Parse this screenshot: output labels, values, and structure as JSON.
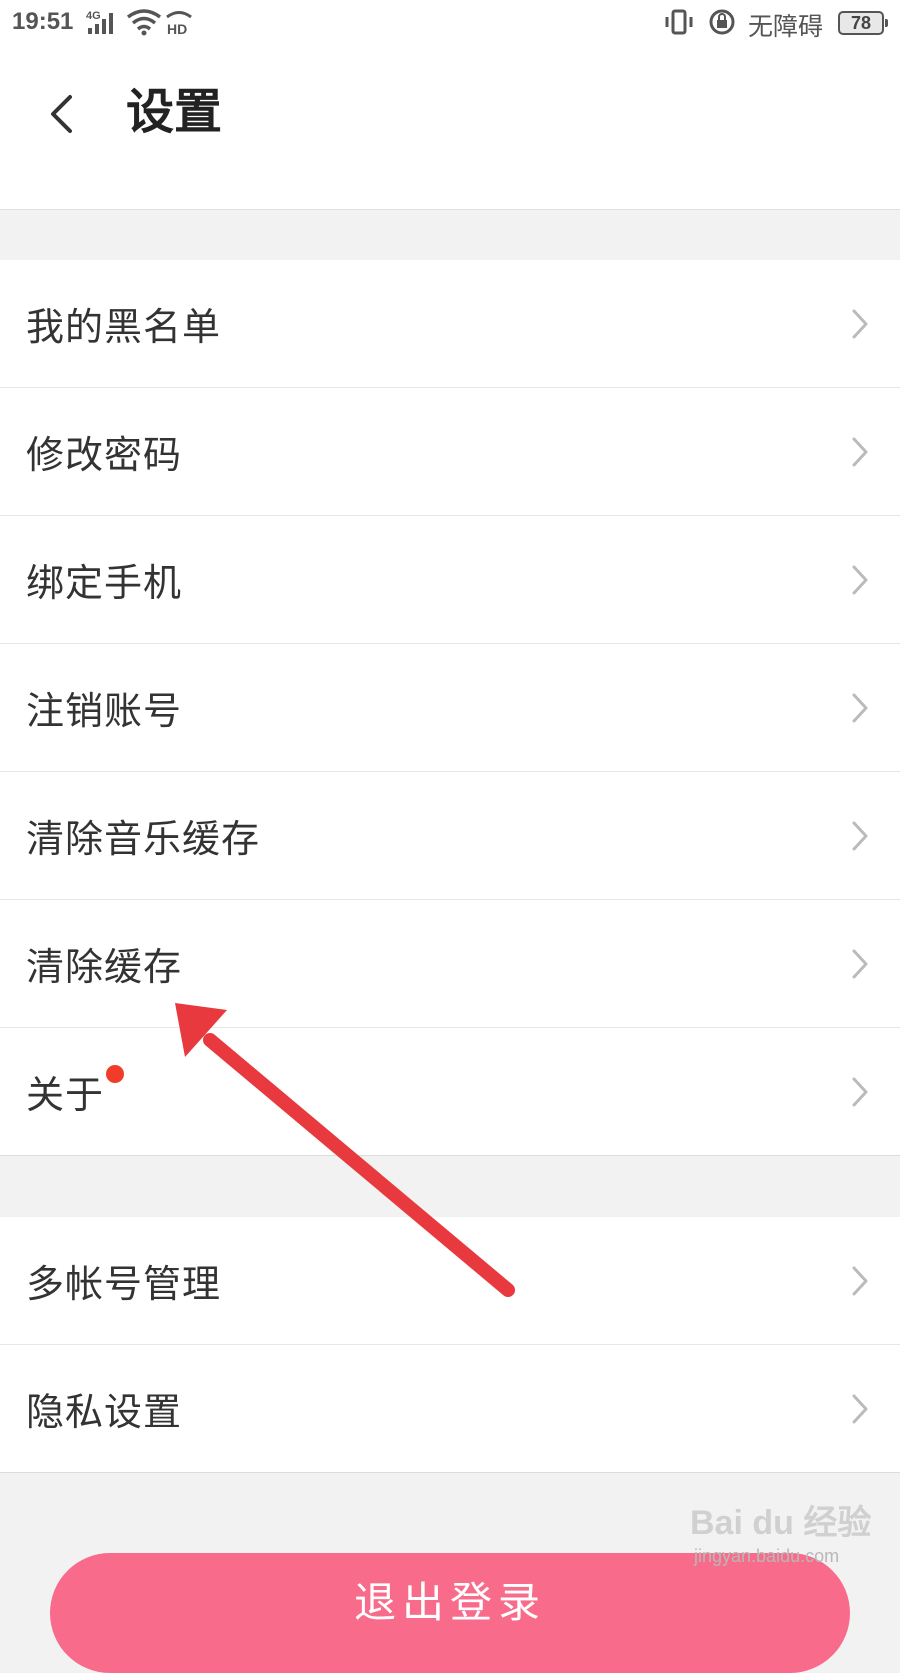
{
  "status_bar": {
    "time": "19:51",
    "network": "4G",
    "hd": "HD",
    "accessibility": "无障碍",
    "battery": "78"
  },
  "header": {
    "title": "设置"
  },
  "settings_group_1": [
    {
      "label": "我的黑名单"
    },
    {
      "label": "修改密码"
    },
    {
      "label": "绑定手机"
    },
    {
      "label": "注销账号"
    },
    {
      "label": "清除音乐缓存"
    },
    {
      "label": "清除缓存"
    },
    {
      "label": "关于",
      "has_red_dot": true
    }
  ],
  "settings_group_2": [
    {
      "label": "多帐号管理"
    },
    {
      "label": "隐私设置"
    }
  ],
  "logout": {
    "label": "退出登录"
  },
  "watermark": {
    "brand": "Bai du 经验",
    "url": "jingyan.baidu.com"
  },
  "colors": {
    "accent_pink": "#f86b8a",
    "annotation_red": "#e8393f",
    "badge_red": "#f23c2a"
  }
}
